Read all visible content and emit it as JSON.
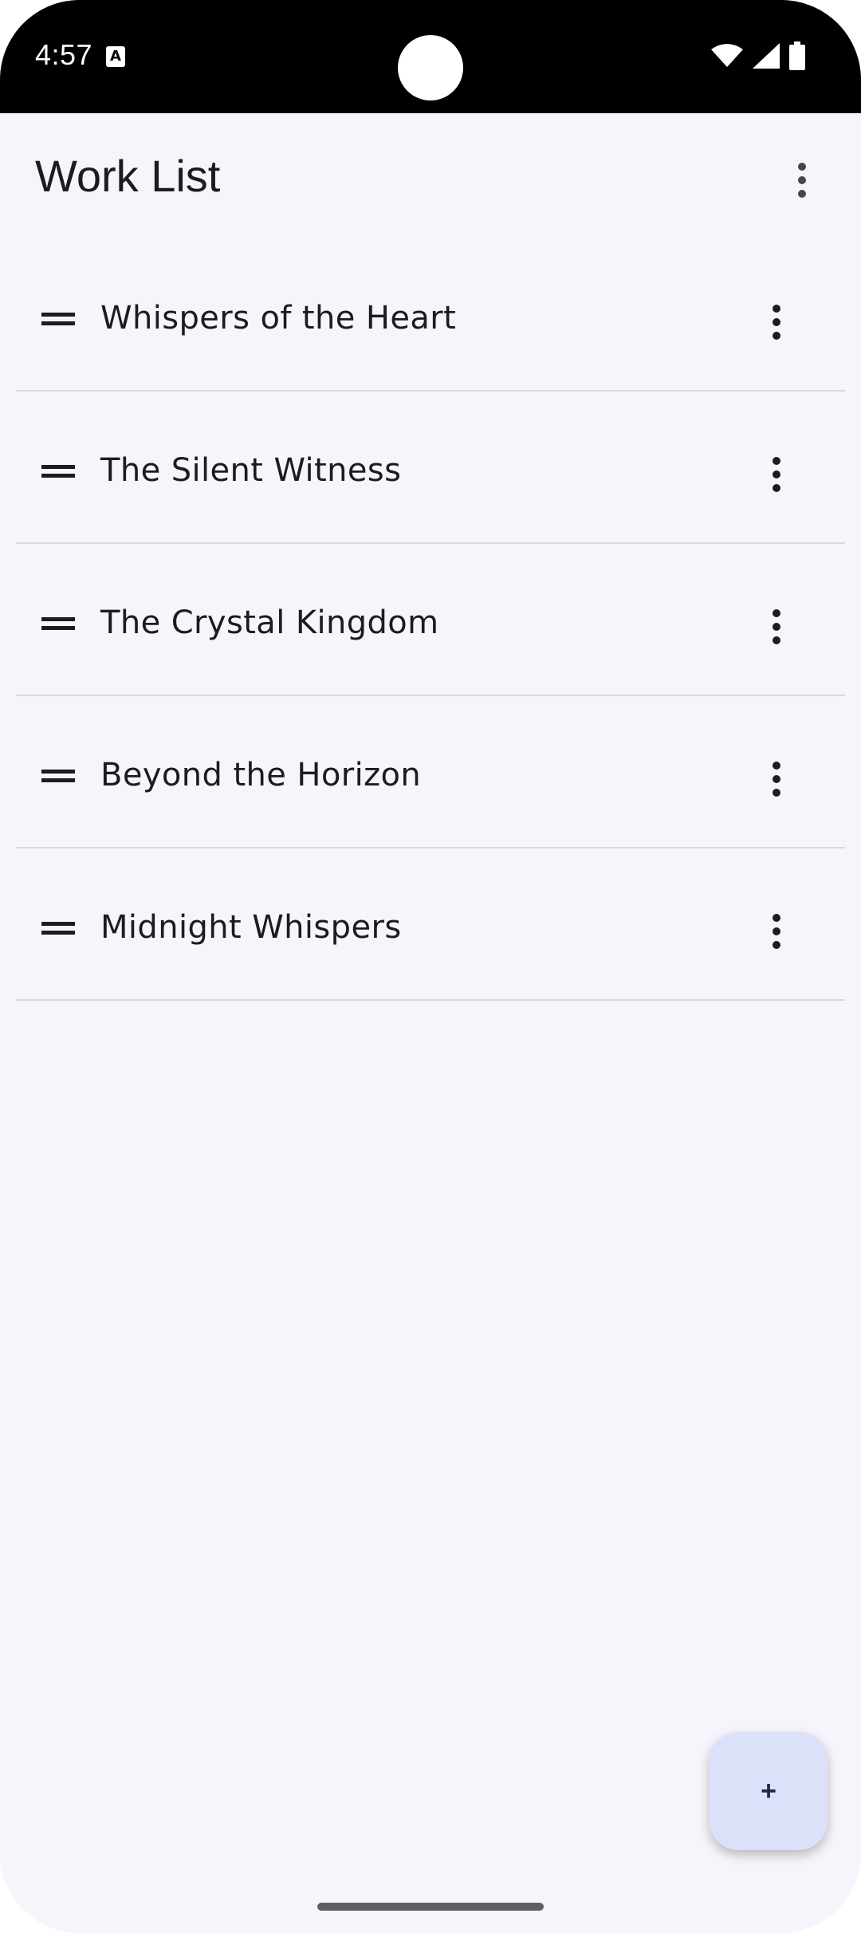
{
  "status_bar": {
    "time": "4:57",
    "notification_icon": "A",
    "icons": [
      "wifi-icon",
      "signal-icon",
      "battery-icon"
    ]
  },
  "app_bar": {
    "title": "Work List",
    "menu_icon": "more-vert-icon"
  },
  "work_list": {
    "items": [
      {
        "title": "Whispers of the Heart"
      },
      {
        "title": "The Silent Witness"
      },
      {
        "title": "The Crystal Kingdom"
      },
      {
        "title": "Beyond the Horizon"
      },
      {
        "title": "Midnight Whispers"
      }
    ]
  },
  "fab": {
    "label": "+",
    "color": "#dbe1f9"
  },
  "colors": {
    "background": "#f6f5fb",
    "text": "#1d1b20",
    "divider": "#d9d8dd"
  }
}
